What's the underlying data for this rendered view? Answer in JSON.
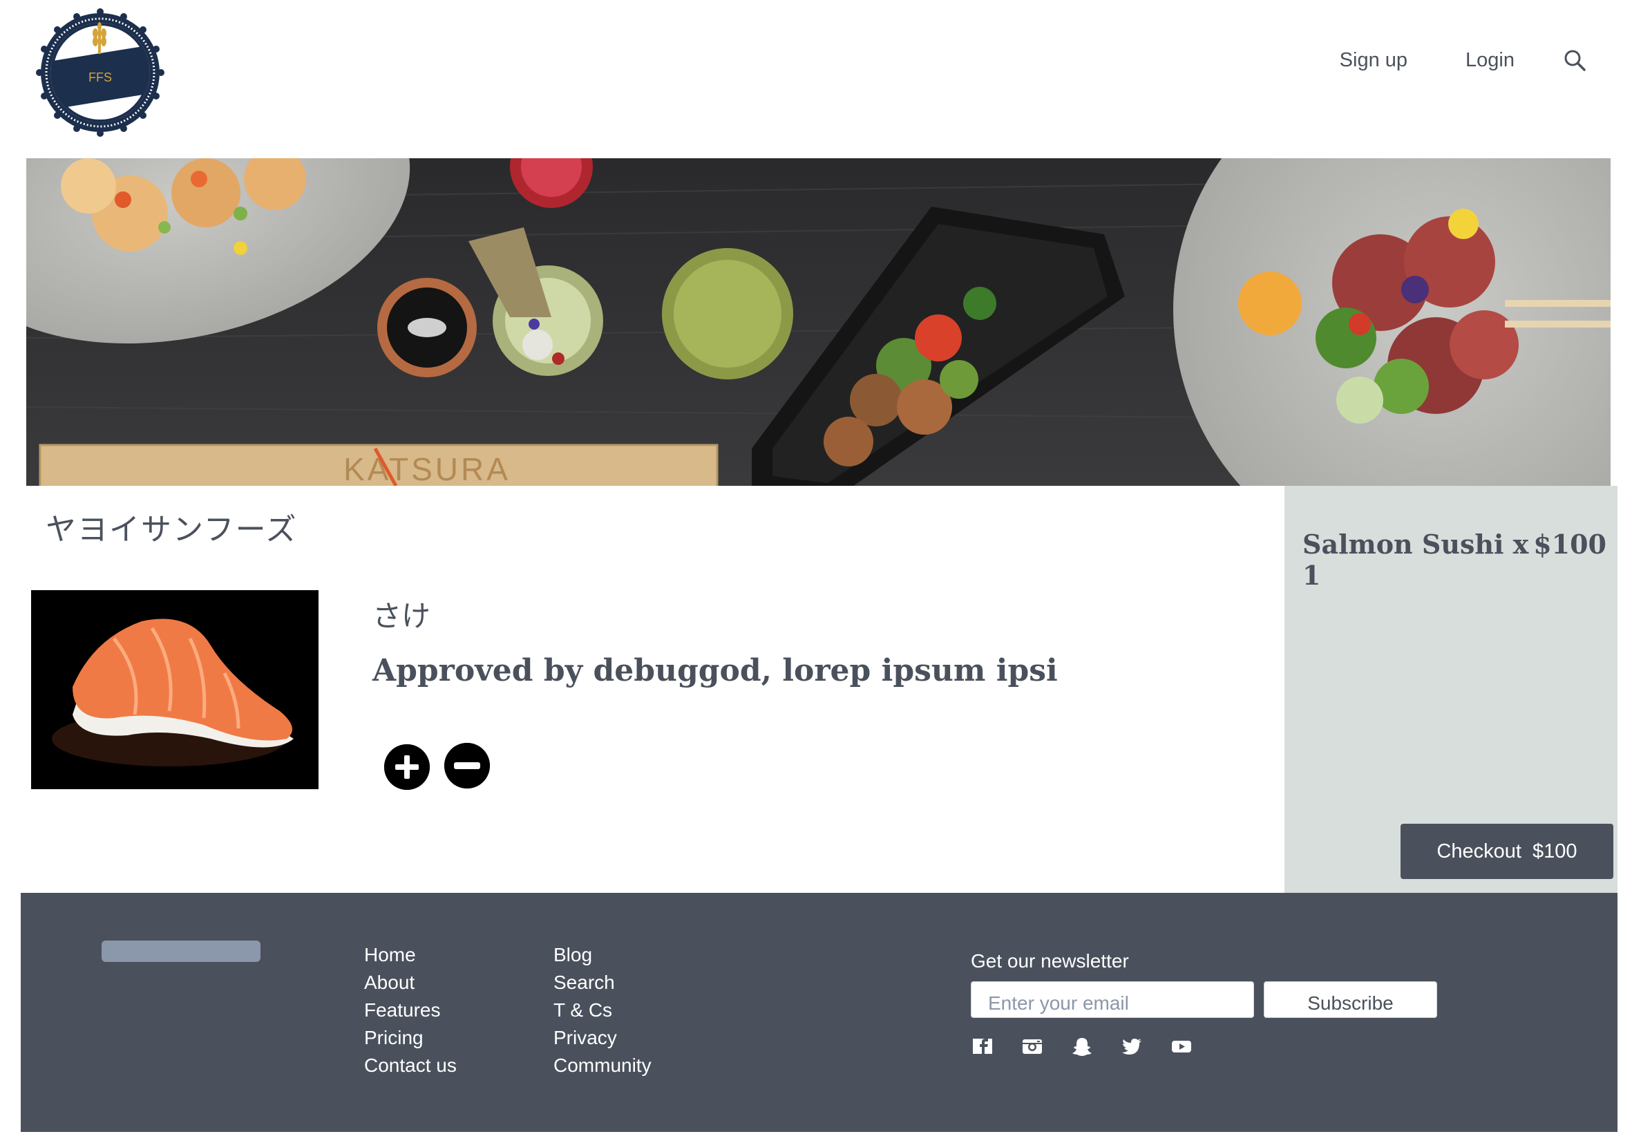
{
  "header": {
    "logo_text": "FFS",
    "nav": {
      "signup": "Sign up",
      "login": "Login"
    },
    "icons": {
      "search": "search-icon"
    }
  },
  "hero": {
    "sign_text": "KATSURA"
  },
  "main": {
    "shop_title": "ヤヨイサンフーズ",
    "item": {
      "name": "さけ",
      "description": "Approved by debuggod, lorep ipsum ipsi",
      "icons": {
        "plus": "plus-circle-icon",
        "minus": "minus-circle-icon"
      }
    }
  },
  "cart": {
    "line_item": "Salmon Sushi x 1",
    "line_price": "$100",
    "checkout_label": "Checkout  $100"
  },
  "footer": {
    "links_col1": [
      "Home",
      "About",
      "Features",
      "Pricing",
      "Contact us"
    ],
    "links_col2": [
      "Blog",
      "Search",
      "T & Cs",
      "Privacy",
      "Community"
    ],
    "newsletter_label": "Get our newsletter",
    "email_placeholder": "Enter your email",
    "subscribe_label": "Subscribe",
    "social_icons": [
      "facebook-icon",
      "instagram-icon",
      "snapchat-icon",
      "twitter-icon",
      "youtube-icon"
    ]
  },
  "colors": {
    "text": "#4a515c",
    "footer_bg": "#4a515c",
    "cart_bg": "#d8dedb",
    "logo_navy": "#1c2f4d",
    "logo_gold": "#d4a43a"
  }
}
